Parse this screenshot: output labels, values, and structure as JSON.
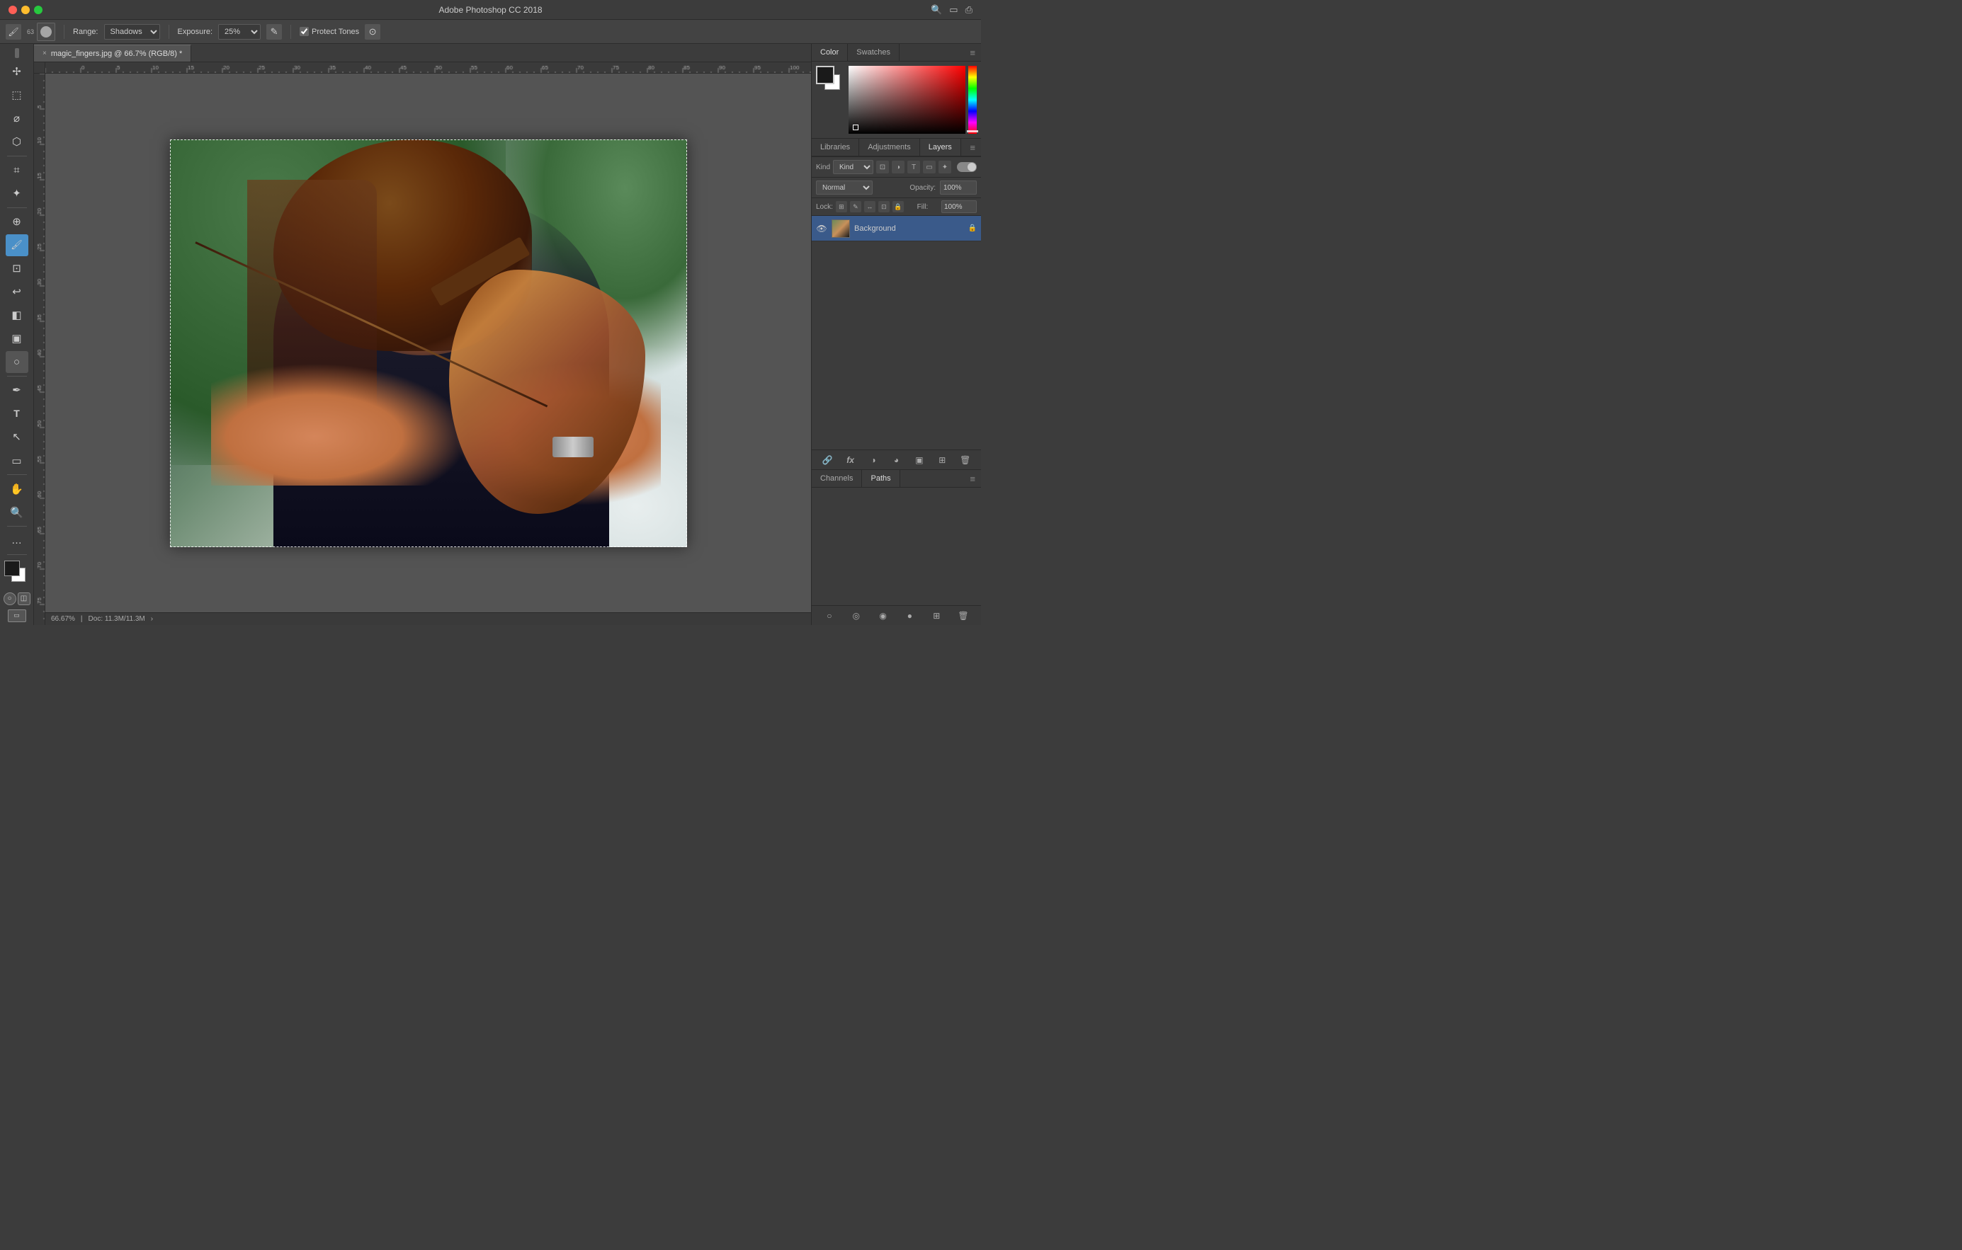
{
  "window": {
    "title": "Adobe Photoshop CC 2018",
    "buttons": {
      "close": "close",
      "minimize": "minimize",
      "maximize": "maximize"
    }
  },
  "options_bar": {
    "tool_icon": "🖌",
    "brush_size": "63",
    "brush_mode_icon": "⬛",
    "range_label": "Range:",
    "range_value": "Shadows",
    "exposure_label": "Exposure:",
    "exposure_value": "25%",
    "set_exposure_icon": "✎",
    "protect_tones_label": "Protect Tones",
    "protect_tones_checked": true,
    "angle_icon": "⊙"
  },
  "document": {
    "tab_label": "magic_fingers.jpg @ 66.7% (RGB/8) *",
    "tab_close": "×",
    "zoom": "66.67%",
    "doc_info": "Doc: 11.3M/11.3M",
    "doc_arrow": "›"
  },
  "right_panel": {
    "color_tab": "Color",
    "swatches_tab": "Swatches",
    "libraries_tab": "Libraries",
    "adjustments_tab": "Adjustments",
    "layers_tab": "Layers",
    "channels_tab": "Channels",
    "paths_tab": "Paths"
  },
  "layers_panel": {
    "kind_label": "Kind",
    "blend_mode": "Normal",
    "opacity_label": "Opacity:",
    "opacity_value": "100%",
    "lock_label": "Lock:",
    "fill_label": "Fill:",
    "fill_value": "100%",
    "layers": [
      {
        "name": "Background",
        "visible": true,
        "locked": true,
        "active": true
      }
    ]
  },
  "toolbar": {
    "tools": [
      {
        "icon": "⊕",
        "name": "move-tool"
      },
      {
        "icon": "⬚",
        "name": "marquee-tool"
      },
      {
        "icon": "⌀",
        "name": "lasso-tool"
      },
      {
        "icon": "⌖",
        "name": "crop-tool"
      },
      {
        "icon": "✏",
        "name": "brush-tool"
      },
      {
        "icon": "⬛",
        "name": "eraser-tool"
      },
      {
        "icon": "∷",
        "name": "stamp-tool"
      },
      {
        "icon": "⊙",
        "name": "dodge-tool"
      },
      {
        "icon": "✦",
        "name": "pen-tool"
      },
      {
        "icon": "T",
        "name": "type-tool"
      },
      {
        "icon": "↖",
        "name": "select-tool"
      },
      {
        "icon": "▭",
        "name": "shape-tool"
      },
      {
        "icon": "✋",
        "name": "hand-tool"
      },
      {
        "icon": "🔍",
        "name": "zoom-tool"
      },
      {
        "icon": "…",
        "name": "more-tools"
      }
    ],
    "fg_color": "#1a1a1a",
    "bg_color": "#ffffff"
  },
  "status_bar": {
    "zoom": "66.67%",
    "doc_info": "Doc: 11.3M/11.3M",
    "arrow": "›"
  }
}
